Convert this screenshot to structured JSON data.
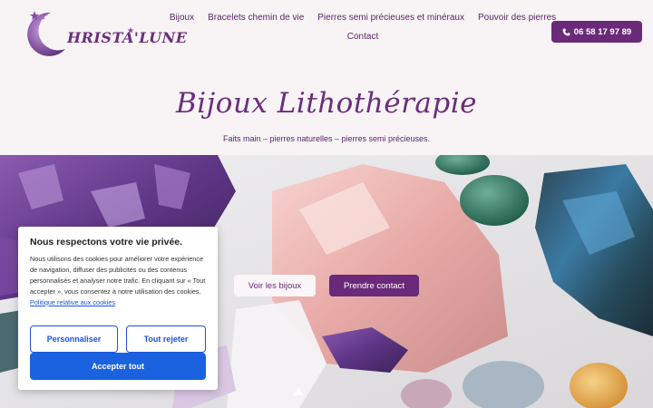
{
  "header": {
    "logo_text": "HRISTA'LUNE",
    "nav_row1": [
      "Bijoux",
      "Bracelets chemin de vie",
      "Pierres semi précieuses et minéraux",
      "Pouvoir des pierres"
    ],
    "nav_row2": [
      "Contact"
    ],
    "phone": "06 58 17 97 89",
    "phone_icon": "phone-icon"
  },
  "hero_title": {
    "title": "Bijoux Lithothérapie",
    "subtitle": "Faits main – pierres naturelles – pierres semi précieuses."
  },
  "hero": {
    "btn_bijoux": "Voir les bijoux",
    "btn_contact": "Prendre contact",
    "scroll_icon": "chevron-up-icon"
  },
  "cookie": {
    "title": "Nous respectons votre vie privée.",
    "text": "Nous utilisons des cookies pour améliorer votre expérience de navigation, diffuser des publicités ou des contenus personnalisés et analyser notre trafic. En cliquant sur « Tout accepter », vous consentez à notre utilisation des cookies.",
    "link": "Politique relative aux cookies",
    "btn_customize": "Personnaliser",
    "btn_reject": "Tout rejeter",
    "btn_accept": "Accepter tout"
  },
  "colors": {
    "brand_purple": "#6a2a79",
    "accept_blue": "#1a62e0",
    "background": "#f8f4f6"
  }
}
